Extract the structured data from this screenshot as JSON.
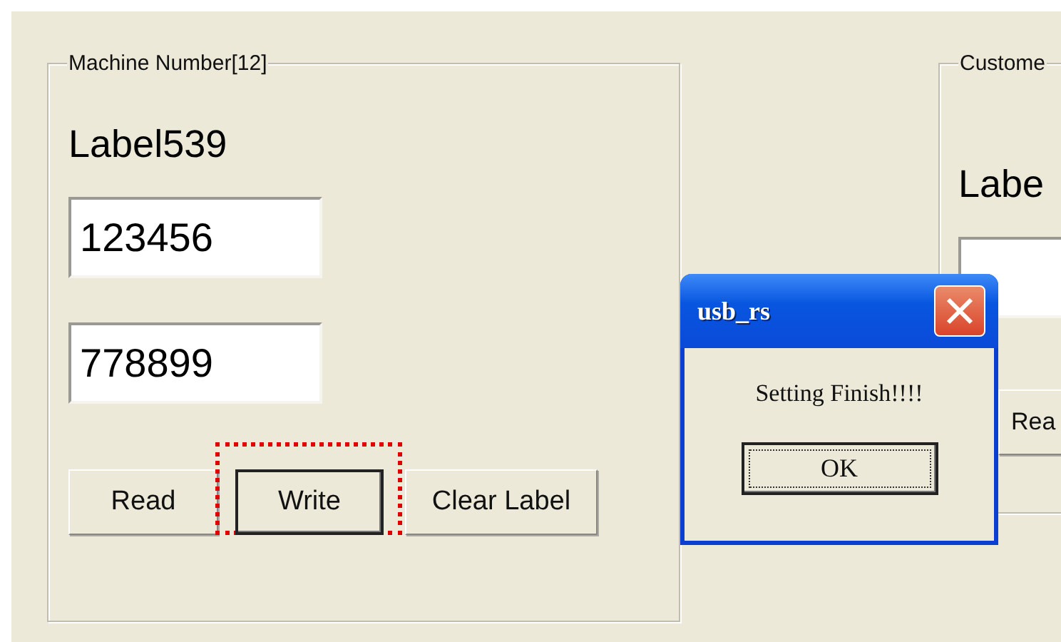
{
  "machine_group": {
    "legend": "Machine Number[12]",
    "label": "Label539",
    "fields": [
      {
        "value": "123456"
      },
      {
        "value": "778899"
      }
    ],
    "buttons": [
      {
        "label": "Read",
        "default": false,
        "highlighted": false
      },
      {
        "label": "Write",
        "default": true,
        "highlighted": true
      },
      {
        "label": "Clear Label",
        "default": false,
        "highlighted": false
      }
    ]
  },
  "customer_group": {
    "legend": "Custome",
    "label": "Labe",
    "button": "Rea"
  },
  "dialog": {
    "title": "usb_rs",
    "message": "Setting Finish!!!!",
    "button": "OK"
  }
}
